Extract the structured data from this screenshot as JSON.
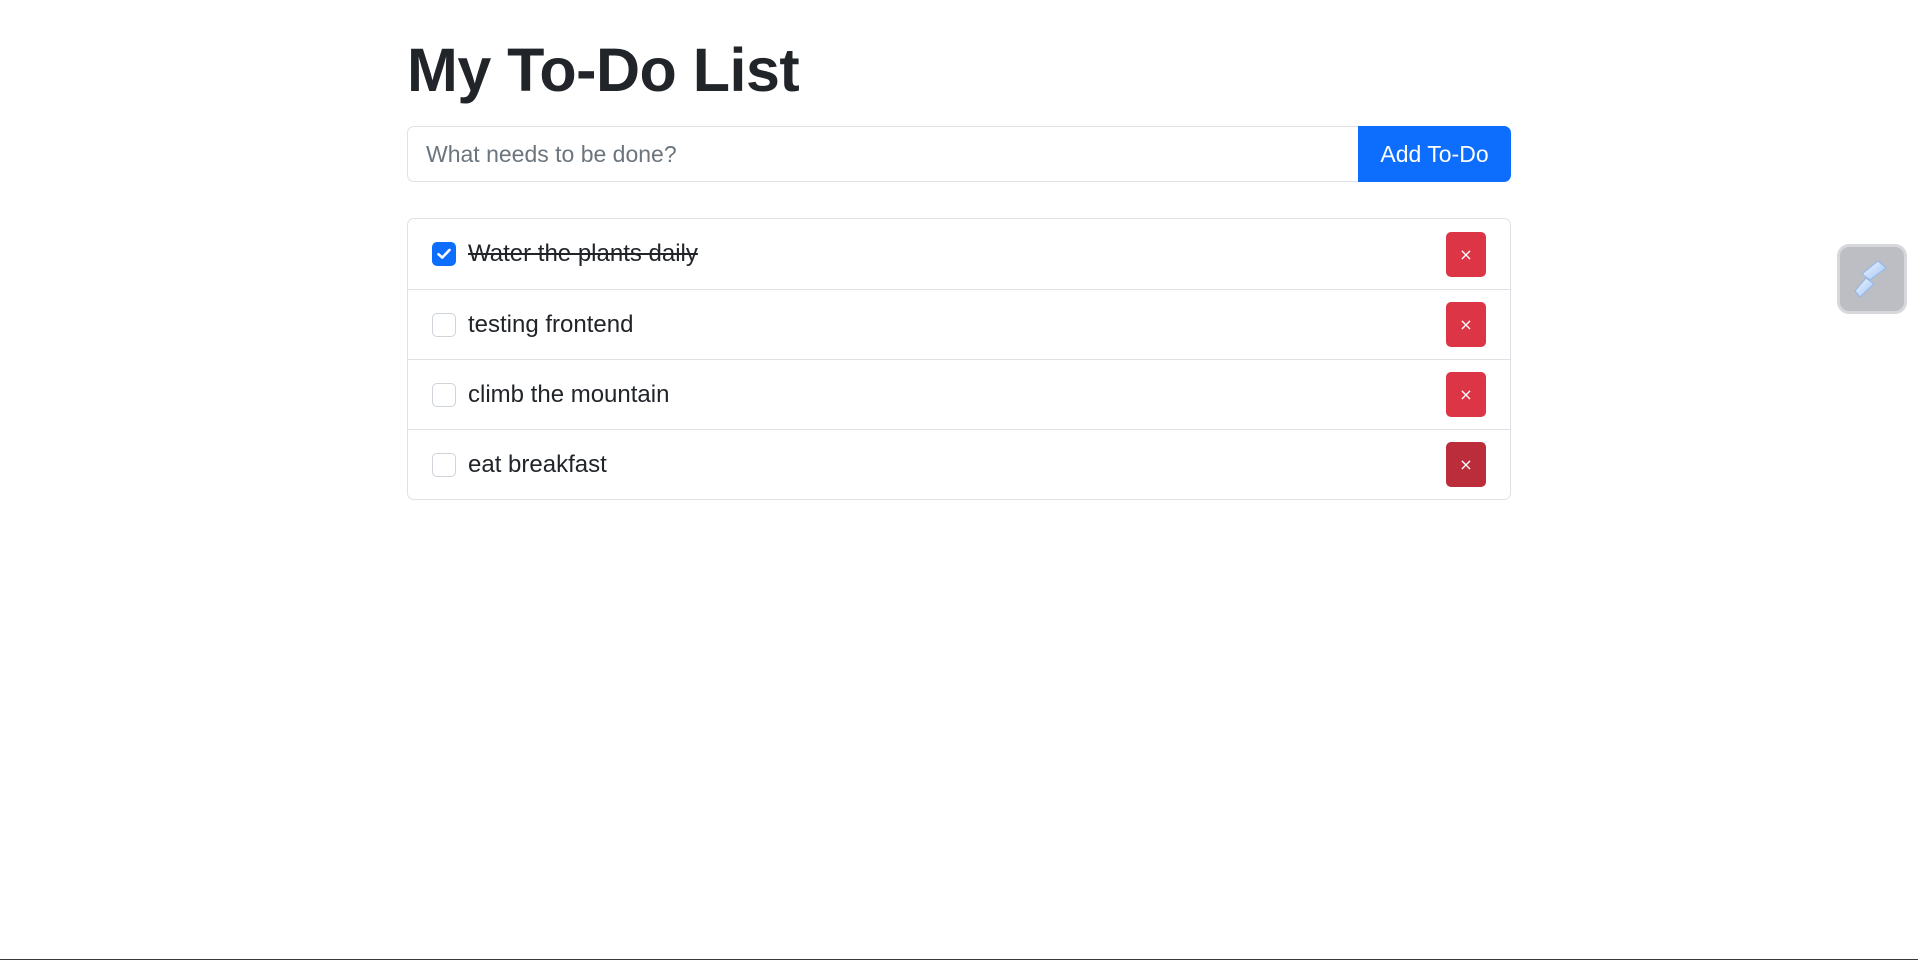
{
  "header": {
    "title": "My To-Do List"
  },
  "form": {
    "placeholder": "What needs to be done?",
    "value": "",
    "add_label": "Add To-Do"
  },
  "todos": [
    {
      "text": "Water the plants daily",
      "completed": true,
      "delete_label": "×"
    },
    {
      "text": "testing frontend",
      "completed": false,
      "delete_label": "×"
    },
    {
      "text": "climb the mountain",
      "completed": false,
      "delete_label": "×"
    },
    {
      "text": "eat breakfast",
      "completed": false,
      "delete_label": "×"
    }
  ],
  "colors": {
    "primary": "#0d6efd",
    "danger": "#dc3545",
    "danger_hover": "#bb2d3b",
    "border": "#dee2e6",
    "text": "#212529"
  },
  "icons": {
    "check": "check-icon",
    "extension": "extension-icon"
  }
}
